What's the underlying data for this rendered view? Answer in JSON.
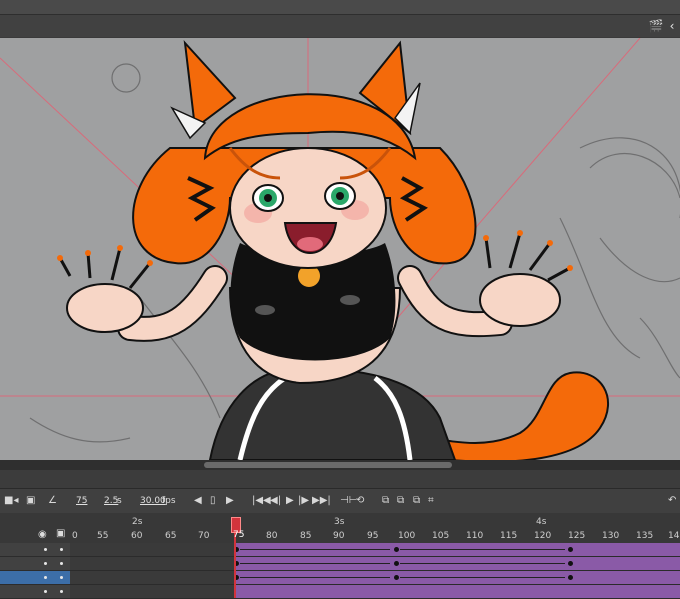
{
  "timeline": {
    "current_frame": "75",
    "duration": "2.5",
    "duration_unit": "s",
    "fps": "30.00",
    "fps_unit": "fps",
    "ruler_seconds": [
      "2s",
      "3s",
      "4s"
    ],
    "ruler_frames": [
      "0",
      "55",
      "60",
      "65",
      "70",
      "75",
      "80",
      "85",
      "90",
      "95",
      "100",
      "105",
      "110",
      "115",
      "120",
      "125",
      "130",
      "135",
      "14"
    ],
    "playhead_label": "75"
  },
  "icons": {
    "clapper": "clapperboard-icon",
    "camera": "camera-icon",
    "layer_parenting": "layer-parenting-icon",
    "graph": "graph-icon",
    "eye": "eye-icon",
    "lock": "lock-icon"
  },
  "colors": {
    "tween": "#8a5aa7",
    "playhead": "#d2343c",
    "selected_layer": "#3c6ea8",
    "stage_bg": "#9fa0a1"
  }
}
